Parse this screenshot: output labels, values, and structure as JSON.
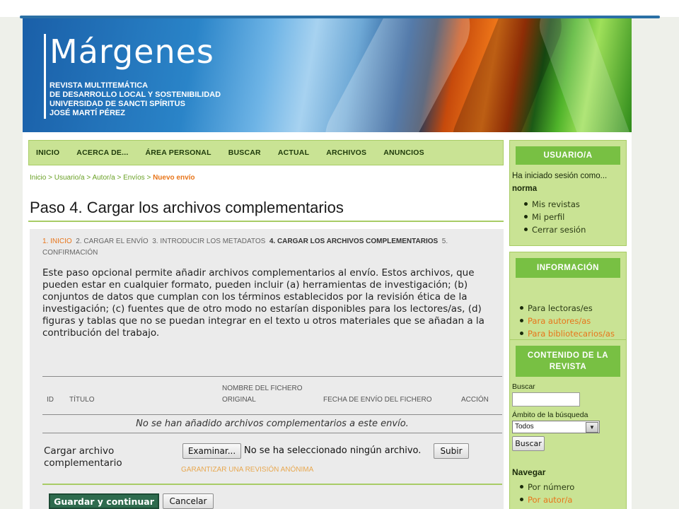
{
  "header": {
    "title": "Márgenes",
    "subtitle_lines": [
      "REVISTA MULTITEMÁTICA",
      "DE DESARROLLO LOCAL Y SOSTENIBILIDAD",
      "UNIVERSIDAD DE SANCTI SPÍRITUS",
      "JOSÉ MARTÍ PÉREZ"
    ]
  },
  "nav": {
    "items": [
      "INICIO",
      "ACERCA DE...",
      "ÁREA PERSONAL",
      "BUSCAR",
      "ACTUAL",
      "ARCHIVOS",
      "ANUNCIOS"
    ]
  },
  "breadcrumb": {
    "items": [
      "Inicio",
      "Usuario/a",
      "Autor/a",
      "Envíos"
    ],
    "separator": " > ",
    "current": "Nuevo envío"
  },
  "page": {
    "title": "Paso 4. Cargar los archivos complementarios"
  },
  "steps": {
    "items": [
      "1. INICIO",
      "2. CARGAR EL ENVÍO",
      "3. INTRODUCIR LOS METADATOS",
      "4. CARGAR LOS ARCHIVOS COMPLEMENTARIOS",
      "5. CONFIRMACIÓN"
    ]
  },
  "intro": {
    "text": "Este paso opcional permite añadir archivos complementarios al envío. Estos archivos, que pueden estar en cualquier formato, pueden incluir (a) herramientas de investigación; (b) conjuntos de datos que cumplan con los términos establecidos por la revisión ética de la investigación; (c) fuentes que de otro modo no estarían disponibles para los lectores/as, (d) figuras y tablas que no se puedan integrar en el texto u otros materiales que se añadan a la contribución del trabajo."
  },
  "table": {
    "headers": {
      "id": "ID",
      "title": "TÍTULO",
      "original_name_line1": "NOMBRE DEL FICHERO",
      "original_name_line2": "ORIGINAL",
      "date": "FECHA DE ENVÍO DEL FICHERO",
      "action": "ACCIÓN"
    },
    "empty_message": "No se han añadido archivos complementarios a este envío."
  },
  "upload": {
    "label": "Cargar archivo complementario",
    "browse_label": "Examinar...",
    "file_status": "No se ha seleccionado ningún archivo.",
    "submit_label": "Subir",
    "anon_link": "GARANTIZAR UNA REVISIÓN ANÓNIMA"
  },
  "actions": {
    "save_label": "Guardar y continuar",
    "cancel_label": "Cancelar"
  },
  "sidebar": {
    "user": {
      "heading": "USUARIO/A",
      "logged_as": "Ha iniciado sesión como...",
      "username": "norma",
      "links": [
        "Mis revistas",
        "Mi perfil",
        "Cerrar sesión"
      ]
    },
    "info": {
      "heading": "INFORMACIÓN",
      "links": [
        "Para lectoras/es",
        "Para autores/as",
        "Para bibliotecarios/as"
      ]
    },
    "content": {
      "heading_line1": "CONTENIDO DE LA",
      "heading_line2": "REVISTA",
      "search_label": "Buscar",
      "scope_label": "Ámbito de la búsqueda",
      "scope_value": "Todos",
      "search_button": "Buscar",
      "browse_label": "Navegar",
      "browse_links": [
        "Por número",
        "Por autor/a"
      ]
    }
  },
  "colors": {
    "accent_green": "#78c043",
    "light_green": "#c9e394",
    "link_orange": "#e8751a",
    "save_button": "#2e6b4e",
    "slide_line": "#2a6fa5"
  }
}
